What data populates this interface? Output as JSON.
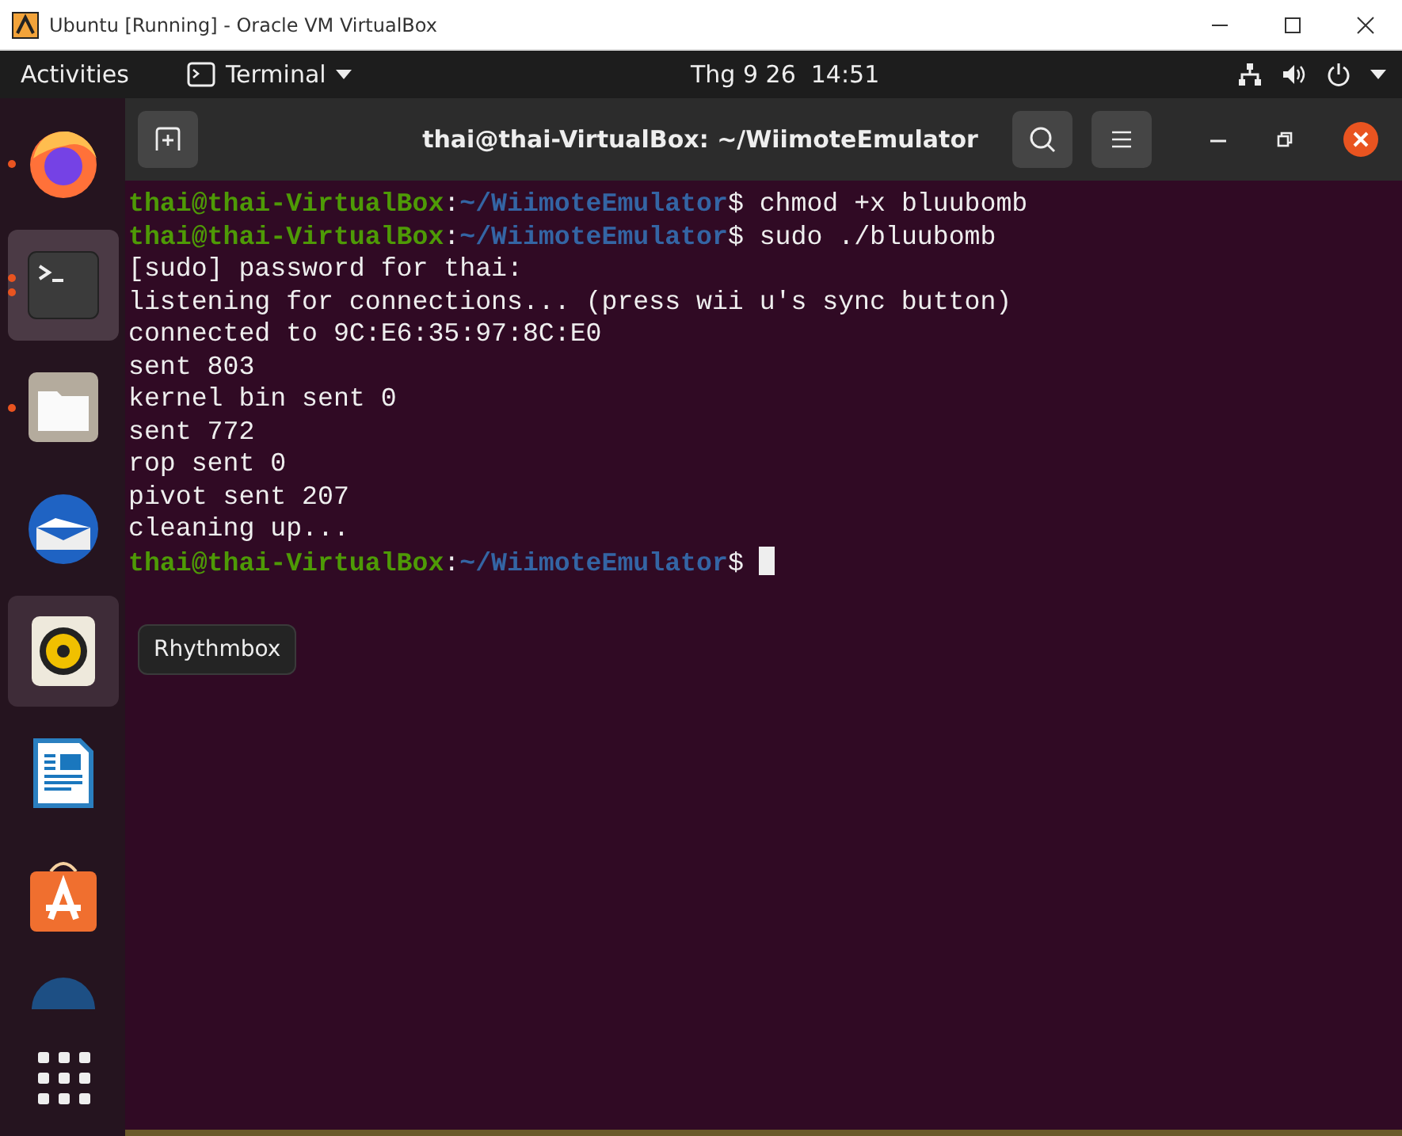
{
  "host_window": {
    "title": "Ubuntu [Running] - Oracle VM VirtualBox"
  },
  "top_bar": {
    "activities": "Activities",
    "app_menu": "Terminal",
    "clock": "Thg 9 26  14:51"
  },
  "dock": {
    "items": [
      {
        "kind": "firefox",
        "running": true,
        "multiple_windows": false,
        "selected": false,
        "hovered": false
      },
      {
        "kind": "terminal",
        "running": true,
        "multiple_windows": true,
        "selected": true,
        "hovered": false
      },
      {
        "kind": "files",
        "running": true,
        "multiple_windows": false,
        "selected": false,
        "hovered": false
      },
      {
        "kind": "thunderbird",
        "running": false,
        "multiple_windows": false,
        "selected": false,
        "hovered": false
      },
      {
        "kind": "rhythmbox",
        "running": false,
        "multiple_windows": false,
        "selected": false,
        "hovered": true
      },
      {
        "kind": "writer",
        "running": false,
        "multiple_windows": false,
        "selected": false,
        "hovered": false
      },
      {
        "kind": "software",
        "running": false,
        "multiple_windows": false,
        "selected": false,
        "hovered": false
      },
      {
        "kind": "partial",
        "running": false,
        "multiple_windows": false,
        "selected": false,
        "hovered": false
      }
    ],
    "tooltip": "Rhythmbox"
  },
  "terminal": {
    "title": "thai@thai-VirtualBox: ~/WiimoteEmulator",
    "lines": [
      {
        "kind": "prompt",
        "user": "thai@thai-VirtualBox",
        "separator": ":",
        "path": "~/WiimoteEmulator",
        "symbol": "$",
        "command": "chmod +x bluubomb",
        "cursor": false
      },
      {
        "kind": "prompt",
        "user": "thai@thai-VirtualBox",
        "separator": ":",
        "path": "~/WiimoteEmulator",
        "symbol": "$",
        "command": "sudo ./bluubomb",
        "cursor": false
      },
      {
        "kind": "output",
        "text": "[sudo] password for thai:"
      },
      {
        "kind": "output",
        "text": "listening for connections... (press wii u's sync button)"
      },
      {
        "kind": "output",
        "text": "connected to 9C:E6:35:97:8C:E0"
      },
      {
        "kind": "output",
        "text": "sent 803"
      },
      {
        "kind": "output",
        "text": "kernel bin sent 0"
      },
      {
        "kind": "output",
        "text": "sent 772"
      },
      {
        "kind": "output",
        "text": "rop sent 0"
      },
      {
        "kind": "output",
        "text": "pivot sent 207"
      },
      {
        "kind": "output",
        "text": "cleaning up..."
      },
      {
        "kind": "prompt",
        "user": "thai@thai-VirtualBox",
        "separator": ":",
        "path": "~/WiimoteEmulator",
        "symbol": "$",
        "cursor": true
      }
    ]
  }
}
